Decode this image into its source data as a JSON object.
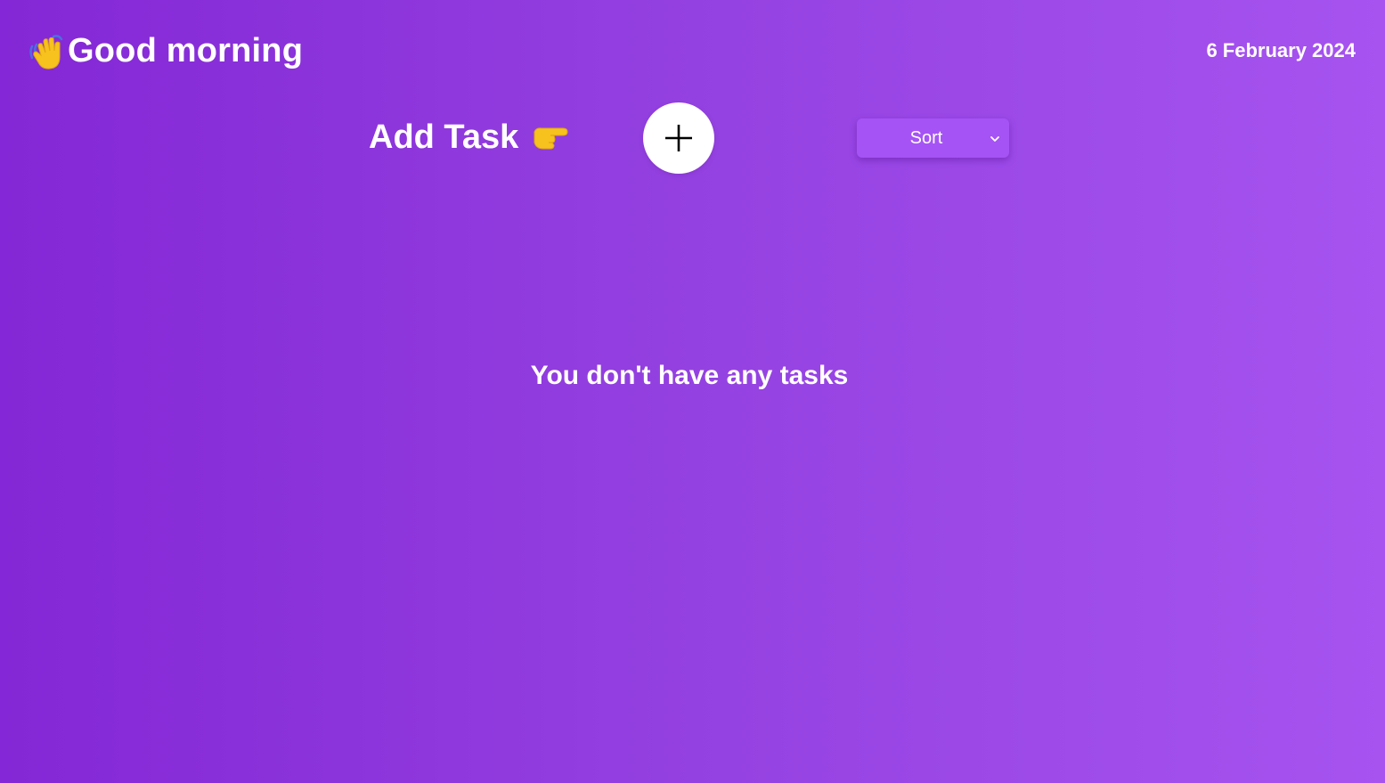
{
  "header": {
    "greeting": "Good morning",
    "greeting_icon": "waving-hand-icon",
    "date": "6 February 2024"
  },
  "toolbar": {
    "add_task_label": "Add Task",
    "add_task_icon": "pointing-right-hand-icon",
    "add_button_icon": "plus-icon",
    "sort": {
      "selected": "Sort",
      "icon": "chevron-down-icon"
    }
  },
  "main": {
    "empty_message": "You don't have any tasks"
  },
  "colors": {
    "background_start": "#8427d6",
    "background_end": "#a653f0",
    "sort_background": "#a653f5",
    "text": "#ffffff",
    "emoji_yellow": "#f7c21e"
  }
}
